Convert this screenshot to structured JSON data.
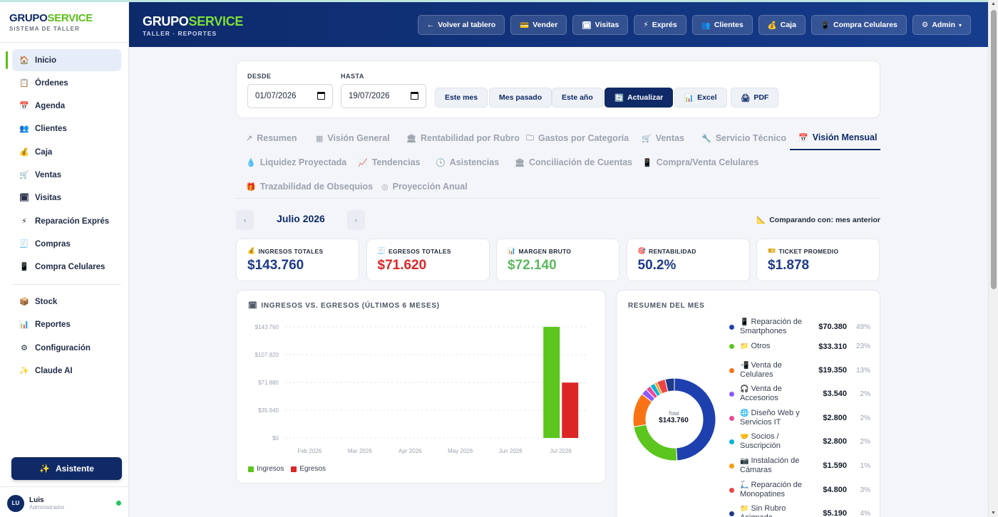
{
  "sidebar": {
    "brand": {
      "part1": "GRUPO",
      "part2": "SERVICE",
      "subtitle": "SISTEMA DE TALLER"
    },
    "items": [
      {
        "label": "Inicio",
        "icon": "🏠",
        "active": true
      },
      {
        "label": "Órdenes",
        "icon": "📋"
      },
      {
        "label": "Agenda",
        "icon": "📅"
      },
      {
        "label": "Clientes",
        "icon": "👥"
      },
      {
        "label": "Caja",
        "icon": "💰"
      },
      {
        "label": "Ventas",
        "icon": "🛒"
      },
      {
        "label": "Visitas",
        "icon": "🗓"
      },
      {
        "label": "Reparación Exprés",
        "icon": "⚡"
      },
      {
        "label": "Compras",
        "icon": "🧾"
      },
      {
        "label": "Compra Celulares",
        "icon": "📱"
      }
    ],
    "items2": [
      {
        "label": "Stock",
        "icon": "📦"
      },
      {
        "label": "Reportes",
        "icon": "📊"
      },
      {
        "label": "Configuración",
        "icon": "⚙"
      },
      {
        "label": "Claude AI",
        "icon": "✨"
      }
    ],
    "assistant_label": "Asistente",
    "user": {
      "initials": "LU",
      "name": "Luis",
      "role": "Administrador"
    }
  },
  "header": {
    "brand": {
      "part1": "GRUPO",
      "part2": "SERVICE",
      "subtitle": "TALLER · REPORTES"
    },
    "buttons": [
      {
        "label": "Volver al tablero",
        "icon": "←"
      },
      {
        "label": "Vender",
        "icon": "💳"
      },
      {
        "label": "Visitas",
        "icon": "🗓"
      },
      {
        "label": "Exprés",
        "icon": "⚡"
      },
      {
        "label": "Clientes",
        "icon": "👥"
      },
      {
        "label": "Caja",
        "icon": "💰"
      },
      {
        "label": "Compra Celulares",
        "icon": "📱"
      },
      {
        "label": "Admin",
        "icon": "⚙",
        "caret": "▾"
      }
    ]
  },
  "filters": {
    "desde_label": "DESDE",
    "desde_value": "01/07/2026",
    "hasta_label": "HASTA",
    "hasta_value": "19/07/2026",
    "buttons": {
      "este_mes": "Este mes",
      "mes_pasado": "Mes pasado",
      "este_anio": "Este año",
      "actualizar": "Actualizar",
      "excel": "Excel",
      "pdf": "PDF"
    }
  },
  "tabs": [
    {
      "label": "Resumen",
      "icon": "↗"
    },
    {
      "label": "Visión General",
      "icon": "▦"
    },
    {
      "label": "Rentabilidad por Rubro",
      "icon": "🏛"
    },
    {
      "label": "Gastos por Categoría",
      "icon": "🗀"
    },
    {
      "label": "Ventas",
      "icon": "🛒"
    },
    {
      "label": "Servicio Técnico",
      "icon": "🔧"
    },
    {
      "label": "Visión Mensual",
      "icon": "📅",
      "active": true
    },
    {
      "label": "Liquidez Proyectada",
      "icon": "💧"
    },
    {
      "label": "Tendencias",
      "icon": "📈"
    },
    {
      "label": "Asistencias",
      "icon": "🕓"
    },
    {
      "label": "Conciliación de Cuentas",
      "icon": "🏛"
    },
    {
      "label": "Compra/Venta Celulares",
      "icon": "📱"
    },
    {
      "label": "Trazabilidad de Obsequios",
      "icon": "🎁"
    },
    {
      "label": "Proyección Anual",
      "icon": "◎"
    }
  ],
  "month_nav": {
    "prev": "‹",
    "label": "Julio 2026",
    "next": "›",
    "compare": "Comparando con: mes anterior",
    "compare_icon": "📐"
  },
  "kpis": [
    {
      "label": "INGRESOS TOTALES",
      "icon": "💰",
      "value": "$143.760",
      "color": "#1e3a8a"
    },
    {
      "label": "EGRESOS TOTALES",
      "icon": "🧾",
      "value": "$71.620",
      "color": "#dc2626"
    },
    {
      "label": "MARGEN BRUTO",
      "icon": "📊",
      "value": "$72.140",
      "color": "#5cb85c"
    },
    {
      "label": "RENTABILIDAD",
      "icon": "🎯",
      "value": "50.2%",
      "color": "#1e3a8a"
    },
    {
      "label": "TICKET PROMEDIO",
      "icon": "🎫",
      "value": "$1.878",
      "color": "#1e3a8a"
    }
  ],
  "chart_card": {
    "title": "INGRESOS VS. EGRESOS (ÚLTIMOS 6 MESES)",
    "icon": "🗓"
  },
  "chart_data": {
    "type": "bar",
    "categories": [
      "Feb 2026",
      "Mar 2026",
      "Apr 2026",
      "May 2026",
      "Jun 2026",
      "Jul 2026"
    ],
    "series": [
      {
        "name": "Ingresos",
        "color": "#5cc51e",
        "values": [
          0,
          0,
          0,
          0,
          0,
          143760
        ]
      },
      {
        "name": "Egresos",
        "color": "#dc2626",
        "values": [
          0,
          0,
          0,
          0,
          0,
          71620
        ]
      }
    ],
    "yticks": [
      "$0",
      "$35.940",
      "$71.880",
      "$107.820",
      "$143.760"
    ],
    "ylim": [
      0,
      143760
    ],
    "grid": true,
    "legend": "bottom-left"
  },
  "summary": {
    "title": "RESUMEN DEL MES",
    "total_label": "Total",
    "total_value": "$143.760",
    "rows": [
      {
        "icon": "📱",
        "name": "Reparación de Smartphones",
        "value": "$70.380",
        "pct": "49%",
        "amount": 70380,
        "color": "#1e40af"
      },
      {
        "icon": "📁",
        "name": "Otros",
        "value": "$33.310",
        "pct": "23%",
        "amount": 33310,
        "color": "#5cc51e"
      },
      {
        "icon": "📲",
        "name": "Venta de Celulares",
        "value": "$19.350",
        "pct": "13%",
        "amount": 19350,
        "color": "#f97316"
      },
      {
        "icon": "🎧",
        "name": "Venta de Accesorios",
        "value": "$3.540",
        "pct": "2%",
        "amount": 3540,
        "color": "#8b5cf6"
      },
      {
        "icon": "🌐",
        "name": "Diseño Web y Servicios IT",
        "value": "$2.800",
        "pct": "2%",
        "amount": 2800,
        "color": "#ec4899"
      },
      {
        "icon": "🤝",
        "name": "Socios / Suscripción",
        "value": "$2.800",
        "pct": "2%",
        "amount": 2800,
        "color": "#06b6d4"
      },
      {
        "icon": "📷",
        "name": "Instalación de Cámaras",
        "value": "$1.590",
        "pct": "1%",
        "amount": 1590,
        "color": "#f59e0b"
      },
      {
        "icon": "🛴",
        "name": "Reparación de Monopatines",
        "value": "$4.800",
        "pct": "3%",
        "amount": 4800,
        "color": "#ef4444"
      },
      {
        "icon": "📁",
        "name": "Sin Rubro Asignado",
        "value": "$5.190",
        "pct": "4%",
        "amount": 5190,
        "color": "#1e3a8a"
      }
    ]
  }
}
